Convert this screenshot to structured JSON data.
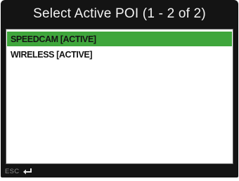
{
  "title": "Select Active POI (1 - 2 of 2)",
  "items": [
    {
      "label": "SPEEDCAM [ACTIVE]",
      "selected": true
    },
    {
      "label": "WIRELESS [ACTIVE]",
      "selected": false
    }
  ],
  "footer": {
    "esc_label": "ESC",
    "enter_icon": "enter-return-icon"
  },
  "colors": {
    "frame": "#141414",
    "selection": "#3fa63c",
    "list_background": "#ffffff",
    "title_text": "#f2f2f2"
  }
}
